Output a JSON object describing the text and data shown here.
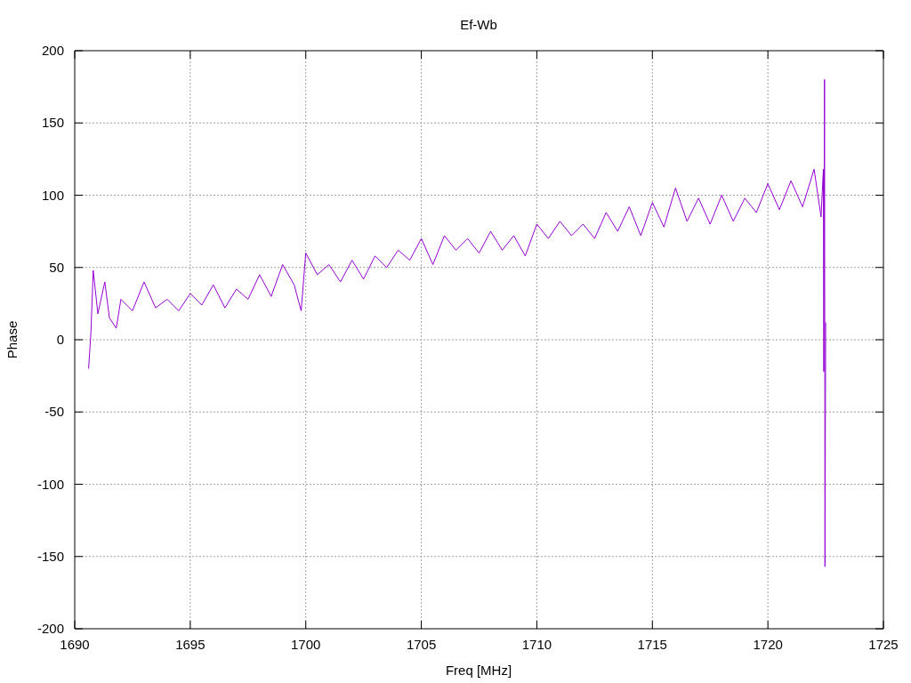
{
  "chart_data": {
    "type": "line",
    "title": "Ef-Wb",
    "xlabel": "Freq [MHz]",
    "ylabel": "Phase",
    "x": [
      1690.6,
      1690.7,
      1690.8,
      1691.0,
      1691.3,
      1691.5,
      1691.8,
      1692.0,
      1692.5,
      1693.0,
      1693.5,
      1694.0,
      1694.5,
      1695.0,
      1695.5,
      1696.0,
      1696.5,
      1697.0,
      1697.5,
      1698.0,
      1698.5,
      1699.0,
      1699.5,
      1699.8,
      1700.0,
      1700.5,
      1701.0,
      1701.5,
      1702.0,
      1702.5,
      1703.0,
      1703.5,
      1704.0,
      1704.5,
      1705.0,
      1705.5,
      1706.0,
      1706.5,
      1707.0,
      1707.5,
      1708.0,
      1708.5,
      1709.0,
      1709.5,
      1710.0,
      1710.5,
      1711.0,
      1711.5,
      1712.0,
      1712.5,
      1713.0,
      1713.5,
      1714.0,
      1714.5,
      1715.0,
      1715.5,
      1716.0,
      1716.5,
      1717.0,
      1717.5,
      1718.0,
      1718.5,
      1719.0,
      1719.5,
      1720.0,
      1720.5,
      1721.0,
      1721.5,
      1722.0,
      1722.3,
      1722.4,
      1722.42,
      1722.45,
      1722.47,
      1722.5
    ],
    "series": [
      {
        "color": "#9400d3",
        "values": [
          -20,
          5,
          48,
          18,
          40,
          15,
          8,
          28,
          20,
          40,
          22,
          28,
          20,
          32,
          24,
          38,
          22,
          35,
          28,
          45,
          30,
          52,
          38,
          20,
          60,
          45,
          52,
          40,
          55,
          42,
          58,
          50,
          62,
          55,
          70,
          52,
          72,
          62,
          70,
          60,
          75,
          62,
          72,
          58,
          80,
          70,
          82,
          72,
          80,
          70,
          88,
          75,
          92,
          72,
          95,
          78,
          105,
          82,
          98,
          80,
          100,
          82,
          98,
          88,
          108,
          90,
          110,
          92,
          118,
          85,
          118,
          -22,
          180,
          -157,
          12
        ]
      }
    ],
    "xlim": [
      1690,
      1725
    ],
    "ylim": [
      -200,
      200
    ],
    "xticks": [
      1690,
      1695,
      1700,
      1705,
      1710,
      1715,
      1720,
      1725
    ],
    "yticks": [
      -200,
      -150,
      -100,
      -50,
      0,
      50,
      100,
      150,
      200
    ],
    "grid": true
  }
}
